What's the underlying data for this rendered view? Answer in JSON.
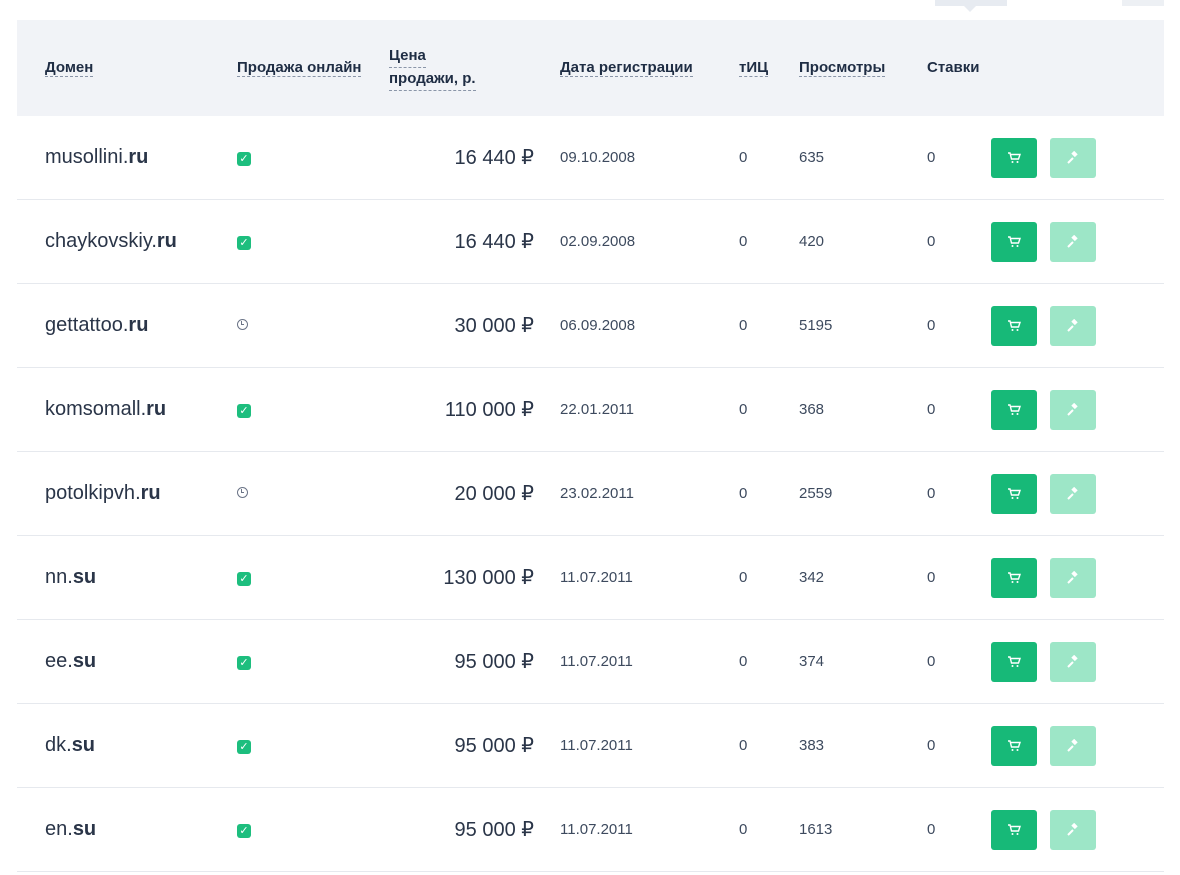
{
  "headers": {
    "domain": "Домен",
    "online": "Продажа онлайн",
    "price_line1": "Цена",
    "price_line2": "продажи, р.",
    "date": "Дата регистрации",
    "tic": "тИЦ",
    "views": "Просмотры",
    "bids": "Ставки"
  },
  "colors": {
    "accent": "#17b978",
    "accent_light": "#9de6c7",
    "header_bg": "#f1f3f7"
  },
  "icons": {
    "online_yes": "check-icon",
    "online_pending": "clock-icon",
    "buy": "cart-icon",
    "bid": "gavel-icon"
  },
  "rows": [
    {
      "name": "musollini",
      "zone": "ru",
      "online": "check",
      "price": "16 440 ₽",
      "date": "09.10.2008",
      "tic": "0",
      "views": "635",
      "bids": "0"
    },
    {
      "name": "chaykovskiy",
      "zone": "ru",
      "online": "check",
      "price": "16 440 ₽",
      "date": "02.09.2008",
      "tic": "0",
      "views": "420",
      "bids": "0"
    },
    {
      "name": "gettattoo",
      "zone": "ru",
      "online": "clock",
      "price": "30 000 ₽",
      "date": "06.09.2008",
      "tic": "0",
      "views": "5195",
      "bids": "0"
    },
    {
      "name": "komsomall",
      "zone": "ru",
      "online": "check",
      "price": "110 000 ₽",
      "date": "22.01.2011",
      "tic": "0",
      "views": "368",
      "bids": "0"
    },
    {
      "name": "potolkipvh",
      "zone": "ru",
      "online": "clock",
      "price": "20 000 ₽",
      "date": "23.02.2011",
      "tic": "0",
      "views": "2559",
      "bids": "0"
    },
    {
      "name": "nn",
      "zone": "su",
      "online": "check",
      "price": "130 000 ₽",
      "date": "11.07.2011",
      "tic": "0",
      "views": "342",
      "bids": "0"
    },
    {
      "name": "ee",
      "zone": "su",
      "online": "check",
      "price": "95 000 ₽",
      "date": "11.07.2011",
      "tic": "0",
      "views": "374",
      "bids": "0"
    },
    {
      "name": "dk",
      "zone": "su",
      "online": "check",
      "price": "95 000 ₽",
      "date": "11.07.2011",
      "tic": "0",
      "views": "383",
      "bids": "0"
    },
    {
      "name": "en",
      "zone": "su",
      "online": "check",
      "price": "95 000 ₽",
      "date": "11.07.2011",
      "tic": "0",
      "views": "1613",
      "bids": "0"
    }
  ]
}
